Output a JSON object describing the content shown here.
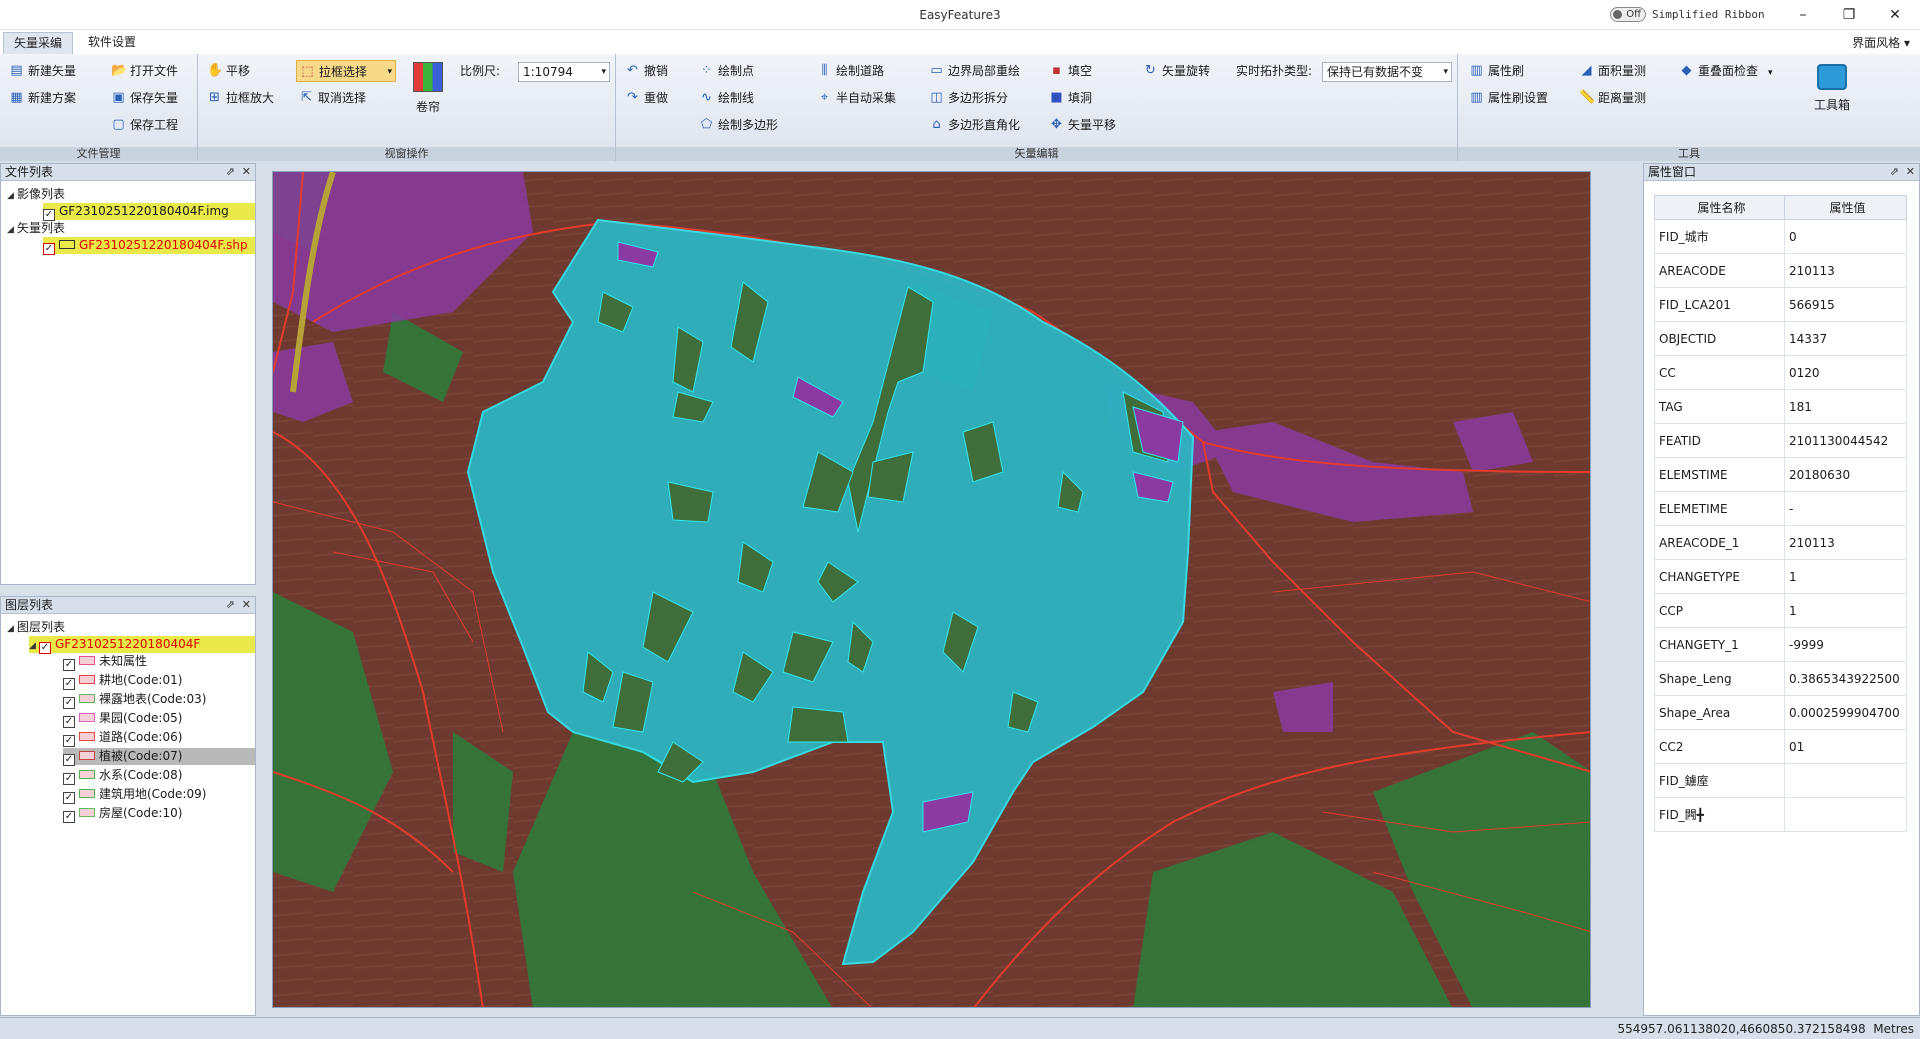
{
  "window": {
    "title": "EasyFeature3",
    "toggle_state": "Off",
    "toggle_label": "Simplified Ribbon"
  },
  "tabs": [
    {
      "label": "矢量采编",
      "active": true
    },
    {
      "label": "软件设置",
      "active": false
    }
  ],
  "style_menu": "界面风格",
  "ribbon": {
    "file_mgmt": {
      "label": "文件管理",
      "new_vector": "新建矢量",
      "new_scheme": "新建方案",
      "open_file": "打开文件",
      "save_vector": "保存矢量",
      "save_project": "保存工程"
    },
    "view_ops": {
      "label": "视窗操作",
      "pan": "平移",
      "box_zoom": "拉框放大",
      "box_select": "拉框选择",
      "cancel_select": "取消选择",
      "curtain": "卷帘",
      "scale_label": "比例尺:",
      "scale_value": "1:10794"
    },
    "vector_edit": {
      "label": "矢量编辑",
      "undo": "撤销",
      "redo": "重做",
      "draw_point": "绘制点",
      "draw_line": "绘制线",
      "draw_polygon": "绘制多边形",
      "draw_road": "绘制道路",
      "semi_auto": "半自动采集",
      "boundary_redraw": "边界局部重绘",
      "polygon_split": "多边形拆分",
      "polygon_rect": "多边形直角化",
      "fill": "填空",
      "fill_hole": "填洞",
      "vector_shift": "矢量平移",
      "vector_rotate": "矢量旋转",
      "topo_label": "实时拓扑类型:",
      "topo_value": "保持已有数据不变"
    },
    "tools": {
      "label": "工具",
      "attr_brush": "属性刷",
      "attr_brush_settings": "属性刷设置",
      "area_measure": "面积量测",
      "dist_measure": "距离量测",
      "overlap_check": "重叠面检查",
      "toolbox": "工具箱"
    }
  },
  "file_panel": {
    "title": "文件列表",
    "image_group": "影像列表",
    "image_file": "GF2310251220180404F.img",
    "vector_group": "矢量列表",
    "vector_file": "GF2310251220180404F.shp"
  },
  "layer_panel": {
    "title": "图层列表",
    "root": "图层列表",
    "layer_name": "GF2310251220180404F",
    "items": [
      {
        "label": "未知属性",
        "color": "#e8518a"
      },
      {
        "label": "耕地(Code:01)",
        "color": "#e8444a"
      },
      {
        "label": "裸露地表(Code:03)",
        "color": "#5fb85f"
      },
      {
        "label": "果园(Code:05)",
        "color": "#e060c0"
      },
      {
        "label": "道路(Code:06)",
        "color": "#e84a3a"
      },
      {
        "label": "植被(Code:07)",
        "color": "#c84040"
      },
      {
        "label": "水系(Code:08)",
        "color": "#48b848"
      },
      {
        "label": "建筑用地(Code:09)",
        "color": "#50b850"
      },
      {
        "label": "房屋(Code:10)",
        "color": "#5fbf5f"
      }
    ]
  },
  "attr_panel": {
    "title": "属性窗口",
    "col_name": "属性名称",
    "col_value": "属性值",
    "rows": [
      {
        "name": "FID_城市",
        "value": "0"
      },
      {
        "name": "AREACODE",
        "value": "210113"
      },
      {
        "name": "FID_LCA201",
        "value": "566915"
      },
      {
        "name": "OBJECTID",
        "value": "14337"
      },
      {
        "name": "CC",
        "value": "0120"
      },
      {
        "name": "TAG",
        "value": "181"
      },
      {
        "name": "FEATID",
        "value": "2101130044542"
      },
      {
        "name": "ELEMSTIME",
        "value": "20180630"
      },
      {
        "name": "ELEMETIME",
        "value": "-"
      },
      {
        "name": "AREACODE_1",
        "value": "210113"
      },
      {
        "name": "CHANGETYPE",
        "value": "1"
      },
      {
        "name": "CCP",
        "value": "1"
      },
      {
        "name": "CHANGETY_1",
        "value": "-9999"
      },
      {
        "name": "Shape_Leng",
        "value": "0.3865343922500"
      },
      {
        "name": "Shape_Area",
        "value": "0.0002599904700"
      },
      {
        "name": "CC2",
        "value": "01"
      },
      {
        "name": "FID_鐪庢",
        "value": ""
      },
      {
        "name": "FID_闁╋",
        "value": ""
      }
    ]
  },
  "status": {
    "coords": "554957.061138020,4660850.372158498",
    "units": "Metres"
  }
}
